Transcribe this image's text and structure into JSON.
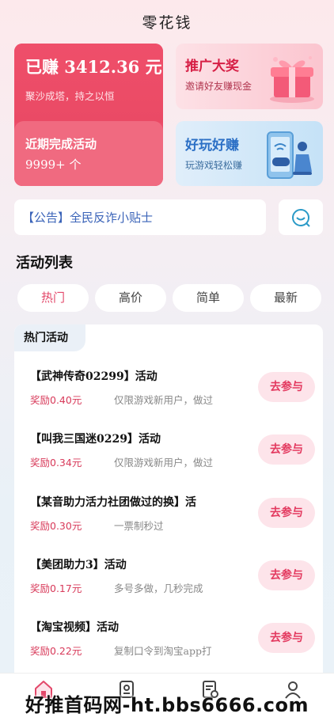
{
  "app": {
    "title": "零花钱"
  },
  "earned": {
    "amount": "已赚 3412.36 元",
    "slogan": "聚沙成塔，持之以恒",
    "recent_label": "近期完成活动",
    "recent_count": "9999+ 个"
  },
  "promo": {
    "title": "推广大奖",
    "subtitle": "邀请好友赚现金"
  },
  "play": {
    "title": "好玩好赚",
    "subtitle": "玩游戏轻松赚"
  },
  "notice": {
    "text": "【公告】全民反诈小贴士"
  },
  "activities": {
    "section_title": "活动列表",
    "tabs": [
      {
        "label": "热门",
        "active": true
      },
      {
        "label": "高价",
        "active": false
      },
      {
        "label": "简单",
        "active": false
      },
      {
        "label": "最新",
        "active": false
      }
    ],
    "list_tag": "热门活动",
    "items": [
      {
        "title": "【武神传奇02299】活动",
        "reward": "奖励0.40元",
        "desc": "仅限游戏新用户，做过",
        "button": "去参与"
      },
      {
        "title": "【叫我三国迷0229】活动",
        "reward": "奖励0.34元",
        "desc": "仅限游戏新用户，做过",
        "button": "去参与"
      },
      {
        "title": "【某音助力活力社团做过的换】活",
        "reward": "奖励0.30元",
        "desc": "一票制秒过",
        "button": "去参与"
      },
      {
        "title": "【美团助力3】活动",
        "reward": "奖励0.17元",
        "desc": "多号多做，几秒完成",
        "button": "去参与"
      },
      {
        "title": "【淘宝视频】活动",
        "reward": "奖励0.22元",
        "desc": "复制口令到淘宝app打",
        "button": "去参与"
      }
    ]
  },
  "bottom_nav": {
    "icons": [
      "home-icon",
      "task-icon",
      "record-icon",
      "profile-icon"
    ],
    "accent": "#e3486a"
  },
  "watermark": "好推首码网-ht.bbs6666.com",
  "colors": {
    "brand": "#ec4d6a",
    "promo_title": "#d61f45",
    "play_title": "#2b6fc5",
    "notice_text": "#3a63b8"
  }
}
